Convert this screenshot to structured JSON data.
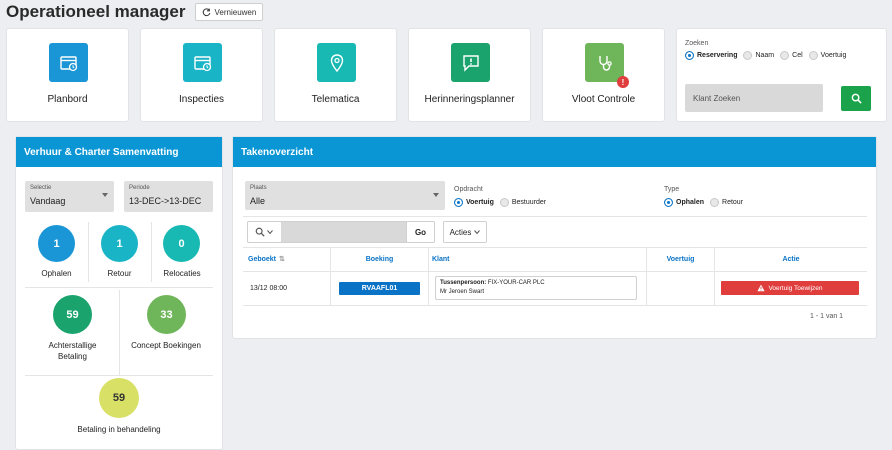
{
  "header": {
    "title": "Operationeel manager",
    "refresh_label": "Vernieuwen"
  },
  "tiles": [
    {
      "label": "Planbord",
      "icon": "calendar-clock-icon",
      "color": "#1a96d6"
    },
    {
      "label": "Inspecties",
      "icon": "calendar-clock-icon",
      "color": "#19b5c7"
    },
    {
      "label": "Telematica",
      "icon": "location-pin-icon",
      "color": "#19b9b3"
    },
    {
      "label": "Herinneringsplanner",
      "icon": "message-alert-icon",
      "color": "#1aa36d"
    },
    {
      "label": "Vloot Controle",
      "icon": "stethoscope-icon",
      "color": "#6fb55a",
      "badge": "!"
    }
  ],
  "search": {
    "caption": "Zoeken",
    "options": [
      "Reservering",
      "Naam",
      "Cel",
      "Voertuig"
    ],
    "selected": "Reservering",
    "placeholder": "Klant Zoeken"
  },
  "summary": {
    "title": "Verhuur & Charter Samenvatting",
    "selectie": {
      "caption": "Selectie",
      "value": "Vandaag"
    },
    "periode": {
      "caption": "Periode",
      "value": "13-DEC->13-DEC"
    },
    "stats": [
      {
        "label": "Ophalen",
        "value": "1",
        "color": "#1a96d6"
      },
      {
        "label": "Retour",
        "value": "1",
        "color": "#19b5c7"
      },
      {
        "label": "Relocaties",
        "value": "0",
        "color": "#19b9b3"
      },
      {
        "label": "Achterstallige Betaling",
        "value": "59",
        "color": "#1aa36d"
      },
      {
        "label": "Concept Boekingen",
        "value": "33",
        "color": "#6fb55a"
      },
      {
        "label": "Betaling in behandeling",
        "value": "59",
        "color": "#d8e066"
      }
    ]
  },
  "tasks": {
    "title": "Takenoverzicht",
    "plaats": {
      "caption": "Plaats",
      "value": "Alle"
    },
    "opdracht": {
      "caption": "Opdracht",
      "options": [
        "Voertuig",
        "Bestuurder"
      ],
      "selected": "Voertuig"
    },
    "type": {
      "caption": "Type",
      "options": [
        "Ophalen",
        "Retour"
      ],
      "selected": "Ophalen"
    },
    "go_label": "Go",
    "acties_label": "Acties",
    "columns": [
      "Geboekt",
      "Boeking",
      "Klant",
      "Voertuig",
      "Actie"
    ],
    "rows": [
      {
        "geboekt": "13/12 08:00",
        "boeking": "RVAAFL01",
        "klant_label": "Tussenpersoon:",
        "klant_company": "FIX-YOUR-CAR PLC",
        "klant_name": "Mr Jeroen Swart",
        "voertuig": "",
        "actie": "Voertuig Toewijzen"
      }
    ],
    "pager": "1 - 1 van 1"
  }
}
